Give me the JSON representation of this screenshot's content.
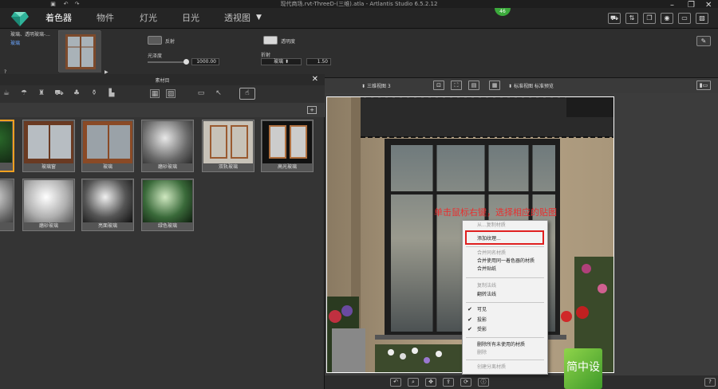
{
  "window": {
    "title": "现代商场.rvt-ThreeD-(三维).atla - Artlantis Studio 6.5.2.12",
    "badge": "46"
  },
  "menu": {
    "items": [
      "着色器",
      "物件",
      "灯光",
      "日光",
      "透视图"
    ],
    "active": "着色器"
  },
  "properties": {
    "material_name": "玻璃、透明玻璃-...",
    "material_sub": "玻璃",
    "reflection_label": "反射",
    "glossiness_label": "光泽度",
    "glossiness_value": "1000.00",
    "transparency_label": "透明度",
    "refraction_label": "折射",
    "refraction_type": "玻璃",
    "refraction_value": "1.50",
    "help": "?"
  },
  "library": {
    "title": "素材目",
    "row1": [
      {
        "label": ""
      },
      {
        "label": "玻璃窗"
      },
      {
        "label": "玻璃"
      },
      {
        "label": "磨砂玻璃"
      },
      {
        "label": "双轨玻璃"
      },
      {
        "label": "高光玻璃"
      }
    ],
    "row2": [
      {
        "label": ""
      },
      {
        "label": "磨砂玻璃"
      },
      {
        "label": "亮面玻璃"
      },
      {
        "label": "绿色玻璃"
      }
    ]
  },
  "viewport": {
    "view_name": "三维视图 3",
    "view_options": "标准视图 标准预览"
  },
  "annotation": "单击鼠标右键，选择相应的贴图",
  "context_menu": {
    "items": [
      {
        "label": "从...复制材质",
        "disabled": true
      },
      {
        "label": "添加纹理...",
        "disabled": false
      },
      {
        "label": "合并同名材质",
        "disabled": true
      },
      {
        "label": "合并使用同一着色器的材质",
        "disabled": false
      },
      {
        "label": "合并贴纸",
        "disabled": false
      },
      {
        "label": "复制法线",
        "disabled": true
      },
      {
        "label": "翻转法线",
        "disabled": false
      },
      {
        "label": "可见",
        "disabled": false,
        "checked": true
      },
      {
        "label": "投影",
        "disabled": false,
        "checked": true
      },
      {
        "label": "受影",
        "disabled": false,
        "checked": true
      },
      {
        "label": "删除所有未使用的材质",
        "disabled": false
      },
      {
        "label": "删除",
        "disabled": true
      },
      {
        "label": "创建分离材质",
        "disabled": true
      }
    ]
  },
  "brand_text": "简中设",
  "colors": {
    "accent": "#f0a020",
    "highlight": "#e02020",
    "annotation": "#e83030",
    "link": "#6aa6ff"
  }
}
